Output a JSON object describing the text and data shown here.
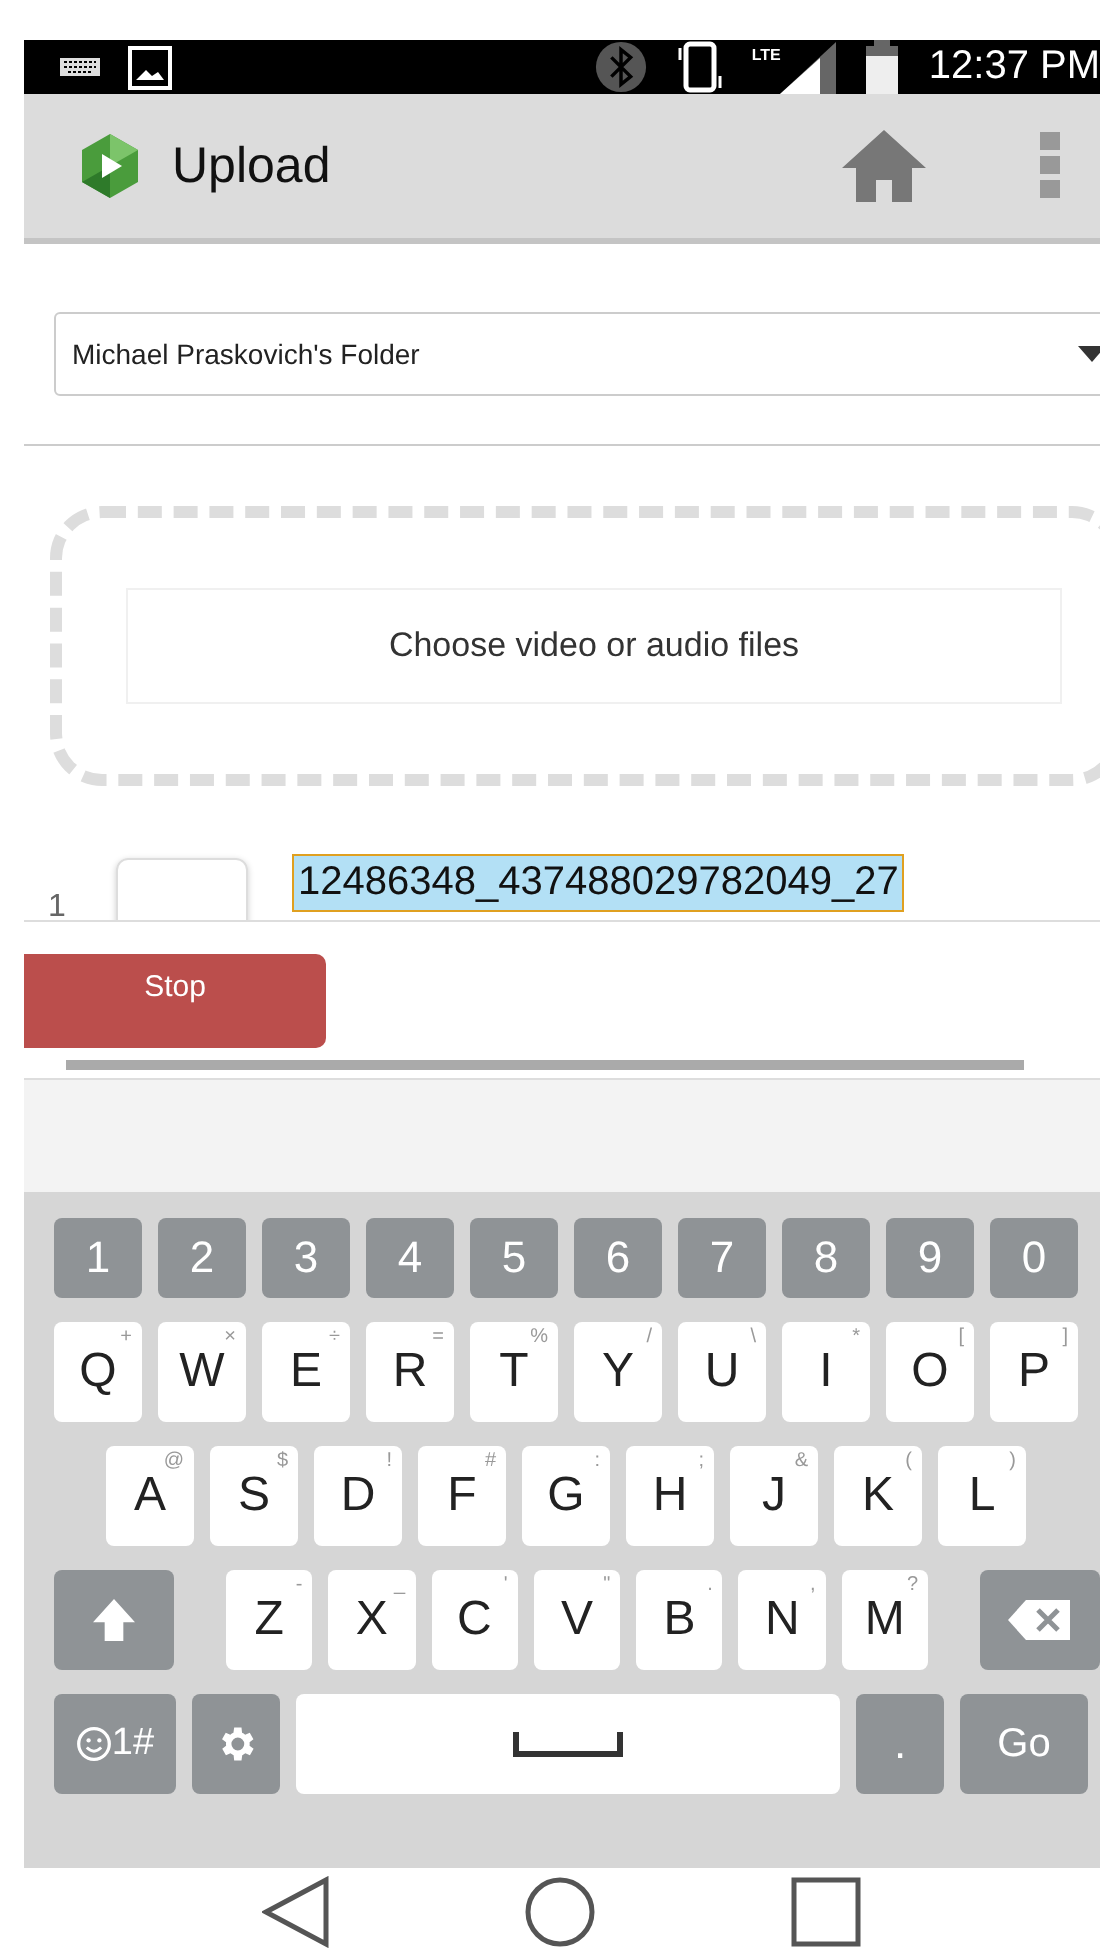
{
  "status_bar": {
    "time": "12:37 PM",
    "network": "LTE"
  },
  "app_bar": {
    "title": "Upload"
  },
  "folder_select": {
    "value": "Michael Praskovich's Folder"
  },
  "dropzone": {
    "label": "Choose video or audio files"
  },
  "files": [
    {
      "index": "1",
      "name": "12486348_437488029782049_27",
      "selected": true
    }
  ],
  "stop_button": {
    "label": "Stop"
  },
  "keyboard": {
    "rows": [
      [
        {
          "kind": "num",
          "label": "1"
        },
        {
          "kind": "num",
          "label": "2"
        },
        {
          "kind": "num",
          "label": "3"
        },
        {
          "kind": "num",
          "label": "4"
        },
        {
          "kind": "num",
          "label": "5"
        },
        {
          "kind": "num",
          "label": "6"
        },
        {
          "kind": "num",
          "label": "7"
        },
        {
          "kind": "num",
          "label": "8"
        },
        {
          "kind": "num",
          "label": "9"
        },
        {
          "kind": "num",
          "label": "0"
        }
      ],
      [
        {
          "kind": "letter",
          "label": "Q",
          "hint": "+"
        },
        {
          "kind": "letter",
          "label": "W",
          "hint": "×"
        },
        {
          "kind": "letter",
          "label": "E",
          "hint": "÷"
        },
        {
          "kind": "letter",
          "label": "R",
          "hint": "="
        },
        {
          "kind": "letter",
          "label": "T",
          "hint": "%"
        },
        {
          "kind": "letter",
          "label": "Y",
          "hint": "/"
        },
        {
          "kind": "letter",
          "label": "U",
          "hint": "\\"
        },
        {
          "kind": "letter",
          "label": "I",
          "hint": "*"
        },
        {
          "kind": "letter",
          "label": "O",
          "hint": "["
        },
        {
          "kind": "letter",
          "label": "P",
          "hint": "]"
        }
      ],
      [
        {
          "kind": "letter",
          "label": "A",
          "hint": "@"
        },
        {
          "kind": "letter",
          "label": "S",
          "hint": "$"
        },
        {
          "kind": "letter",
          "label": "D",
          "hint": "!"
        },
        {
          "kind": "letter",
          "label": "F",
          "hint": "#"
        },
        {
          "kind": "letter",
          "label": "G",
          "hint": ":"
        },
        {
          "kind": "letter",
          "label": "H",
          "hint": ";"
        },
        {
          "kind": "letter",
          "label": "J",
          "hint": "&"
        },
        {
          "kind": "letter",
          "label": "K",
          "hint": "("
        },
        {
          "kind": "letter",
          "label": "L",
          "hint": ")"
        }
      ],
      [
        {
          "kind": "shift"
        },
        {
          "kind": "letter",
          "label": "Z",
          "hint": "-"
        },
        {
          "kind": "letter",
          "label": "X",
          "hint": "_"
        },
        {
          "kind": "letter",
          "label": "C",
          "hint": "'"
        },
        {
          "kind": "letter",
          "label": "V",
          "hint": "\""
        },
        {
          "kind": "letter",
          "label": "B",
          "hint": "."
        },
        {
          "kind": "letter",
          "label": "N",
          "hint": ","
        },
        {
          "kind": "letter",
          "label": "M",
          "hint": "?"
        },
        {
          "kind": "backspace"
        }
      ],
      [
        {
          "kind": "symbols",
          "label": "1#"
        },
        {
          "kind": "settings"
        },
        {
          "kind": "space"
        },
        {
          "kind": "period",
          "label": "."
        },
        {
          "kind": "go",
          "label": "Go"
        }
      ]
    ]
  }
}
